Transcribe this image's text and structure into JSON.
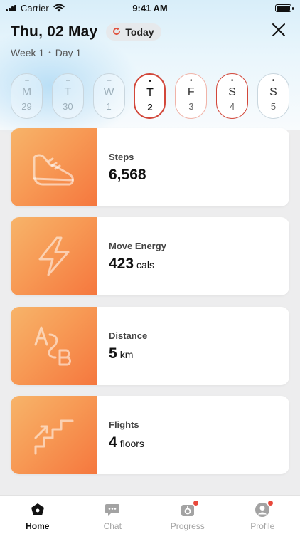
{
  "status": {
    "carrier": "Carrier",
    "time": "9:41 AM"
  },
  "header": {
    "date": "Thu, 02 May",
    "today_label": "Today",
    "week": "Week 1",
    "day": "Day 1"
  },
  "days": [
    {
      "mark": "–",
      "letter": "M",
      "num": "29",
      "state": "past"
    },
    {
      "mark": "–",
      "letter": "T",
      "num": "30",
      "state": "past"
    },
    {
      "mark": "–",
      "letter": "W",
      "num": "1",
      "state": "past"
    },
    {
      "mark": "•",
      "letter": "T",
      "num": "2",
      "state": "active"
    },
    {
      "mark": "•",
      "letter": "F",
      "num": "3",
      "state": "future"
    },
    {
      "mark": "•",
      "letter": "S",
      "num": "4",
      "state": "future-strong"
    },
    {
      "mark": "•",
      "letter": "S",
      "num": "5",
      "state": "past-plain"
    }
  ],
  "cards": [
    {
      "label": "Steps",
      "value": "6,568",
      "unit": "",
      "icon": "sneaker-icon"
    },
    {
      "label": "Move Energy",
      "value": "423",
      "unit": "cals",
      "icon": "lightning-icon"
    },
    {
      "label": "Distance",
      "value": "5",
      "unit": "km",
      "icon": "a-to-b-icon"
    },
    {
      "label": "Flights",
      "value": "4",
      "unit": "floors",
      "icon": "stairs-icon"
    }
  ],
  "tabs": [
    {
      "label": "Home",
      "icon": "home-icon",
      "active": true,
      "badge": false
    },
    {
      "label": "Chat",
      "icon": "chat-icon",
      "active": false,
      "badge": false
    },
    {
      "label": "Progress",
      "icon": "progress-icon",
      "active": false,
      "badge": true
    },
    {
      "label": "Profile",
      "icon": "profile-icon",
      "active": false,
      "badge": true
    }
  ],
  "colors": {
    "accent": "#d2473a",
    "card_gradient_start": "#f7b46a",
    "card_gradient_end": "#f5773e",
    "badge": "#e8483b"
  }
}
